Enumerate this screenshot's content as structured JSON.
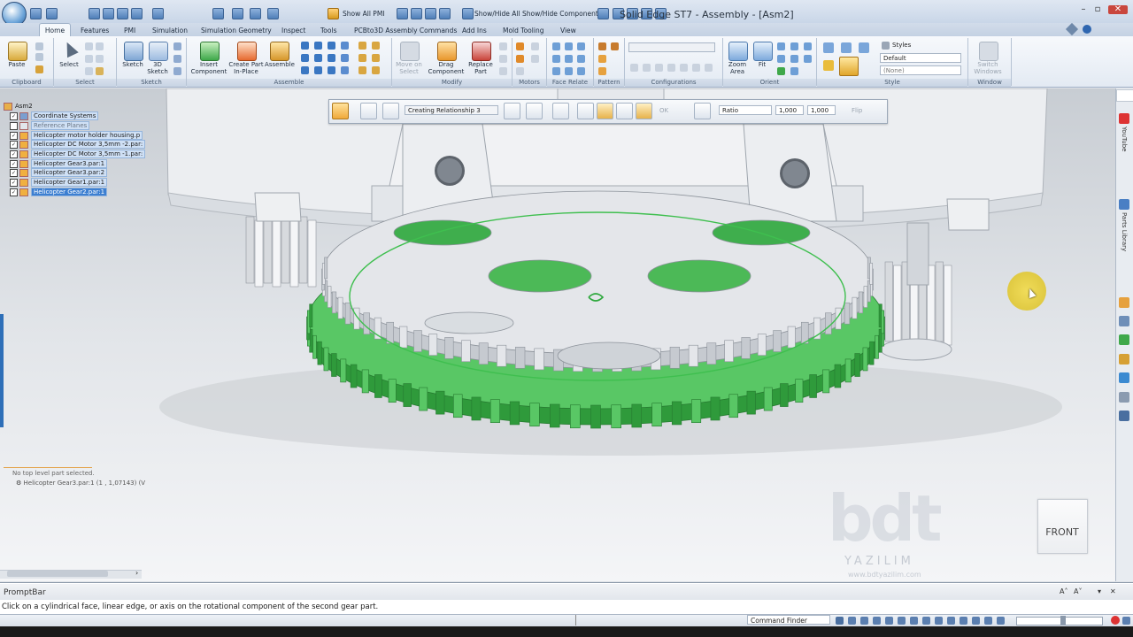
{
  "titlebar": {
    "title": "Solid Edge ST7 - Assembly - [Asm2]",
    "show_all_pmi": "Show All PMI",
    "show_hide_all": "Show/Hide All",
    "show_hide_component": "Show/Hide Component"
  },
  "tabs": [
    "Home",
    "Features",
    "PMI",
    "Simulation",
    "Simulation Geometry",
    "Inspect",
    "Tools",
    "PCBto3D Assembly Commands",
    "Add Ins",
    "Mold Tooling",
    "View"
  ],
  "ribbon": {
    "groups": [
      "Clipboard",
      "Select",
      "Sketch",
      "Assemble",
      "Modify",
      "Motors",
      "Face Relate",
      "Pattern",
      "Configurations",
      "Orient",
      "Style",
      "Window"
    ],
    "paste": "Paste",
    "select": "Select",
    "sketch": "Sketch",
    "sketch3d_l1": "3D",
    "sketch3d_l2": "Sketch",
    "insert_l1": "Insert",
    "insert_l2": "Component",
    "create_l1": "Create Part",
    "create_l2": "In-Place",
    "assemble": "Assemble",
    "move_l1": "Move on",
    "move_l2": "Select",
    "drag_l1": "Drag",
    "drag_l2": "Component",
    "replace_l1": "Replace",
    "replace_l2": "Part",
    "zoom_l1": "Zoom",
    "zoom_l2": "Area",
    "fit": "Fit",
    "styles_label": "Styles",
    "style_value": "Default",
    "style_none": "(None)",
    "switch_l1": "Switch",
    "switch_l2": "Windows"
  },
  "commandbar": {
    "relationship": "Creating Relationship 3",
    "ok": "OK",
    "ratio": "Ratio",
    "value1": "1,000",
    "value2": "1,000",
    "flip": "Flip"
  },
  "tree": {
    "root": "Asm2",
    "items": [
      "Coordinate Systems",
      "Reference Planes",
      "Helicopter motor holder housing.p",
      "Helicopter DC Motor 3,5mm -2.par:",
      "Helicopter DC Motor 3,5mm -1.par:",
      "Helicopter Gear3.par:1",
      "Helicopter Gear3.par:2",
      "Helicopter Gear1.par:1",
      "Helicopter Gear2.par:1"
    ],
    "no_selection": "No top level part selected.",
    "selected_detail": "Helicopter Gear3.par:1   (1 , 1,07143)   (V"
  },
  "viewport": {
    "view_cube_label": "FRONT",
    "watermark_logo": "bdt",
    "watermark_company": "YAZILIM",
    "watermark_url": "www.bdtyazilim.com"
  },
  "sidestrip": {
    "youtube": "YouTube",
    "parts_library": "Parts Library"
  },
  "promptbar": {
    "title": "PromptBar",
    "message": "Click on a cylindrical face, linear edge, or axis on the rotational component of the second gear part."
  },
  "statusbar": {
    "command_finder": "Command Finder"
  },
  "colors": {
    "accent": "#2a6ebb",
    "selection_green": "#3fbf4f",
    "gear_gray": "#e6e8ec"
  }
}
